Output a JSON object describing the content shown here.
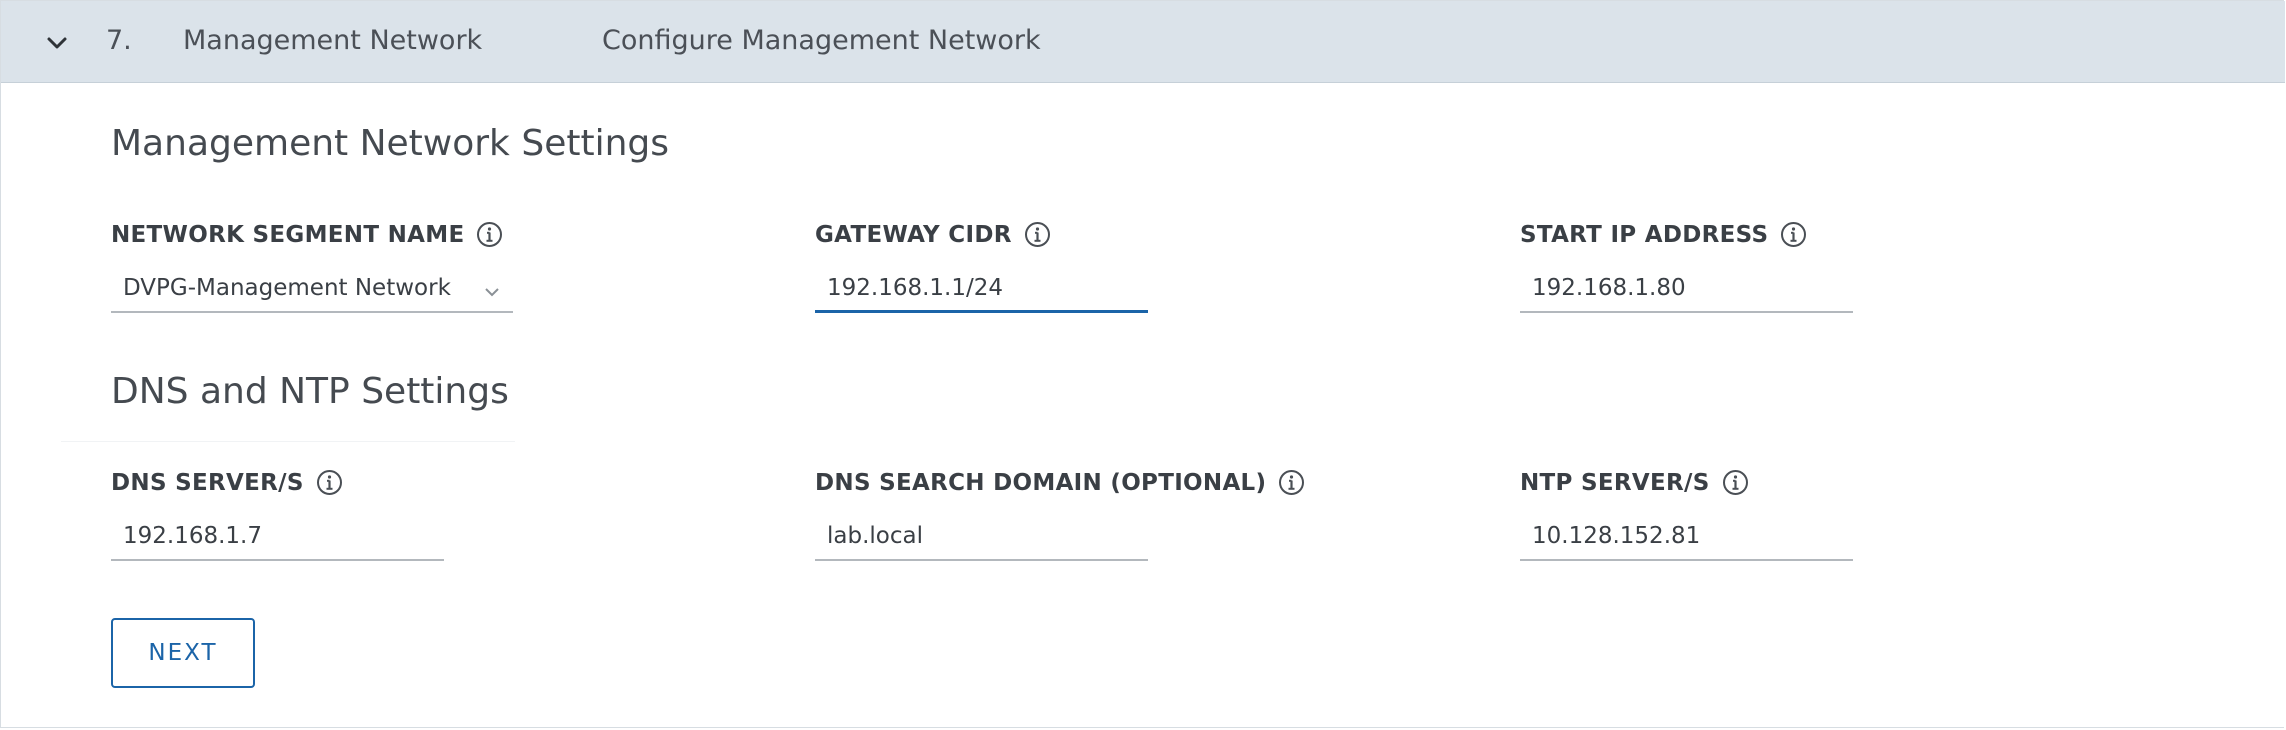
{
  "step": {
    "number": "7.",
    "title": "Management Network",
    "description": "Configure Management Network"
  },
  "management_section": {
    "title": "Management Network Settings",
    "network_segment": {
      "label": "NETWORK SEGMENT NAME",
      "value": "DVPG-Management Network"
    },
    "gateway_cidr": {
      "label": "GATEWAY CIDR",
      "value": "192.168.1.1/24"
    },
    "start_ip": {
      "label": "START IP ADDRESS",
      "value": "192.168.1.80"
    }
  },
  "dns_ntp_section": {
    "title": "DNS and NTP Settings",
    "dns_servers": {
      "label": "DNS SERVER/S",
      "value": "192.168.1.7"
    },
    "dns_search_domain": {
      "label": "DNS SEARCH DOMAIN (OPTIONAL)",
      "value": "lab.local"
    },
    "ntp_servers": {
      "label": "NTP SERVER/S",
      "value": "10.128.152.81"
    }
  },
  "actions": {
    "next_label": "NEXT"
  },
  "colors": {
    "header_bg": "#dbe3ea",
    "accent": "#1b64a8",
    "text": "#3a3f45"
  },
  "icons": {
    "expand": "chevron-down-icon",
    "info": "info-icon",
    "dropdown": "caret-down-icon"
  }
}
